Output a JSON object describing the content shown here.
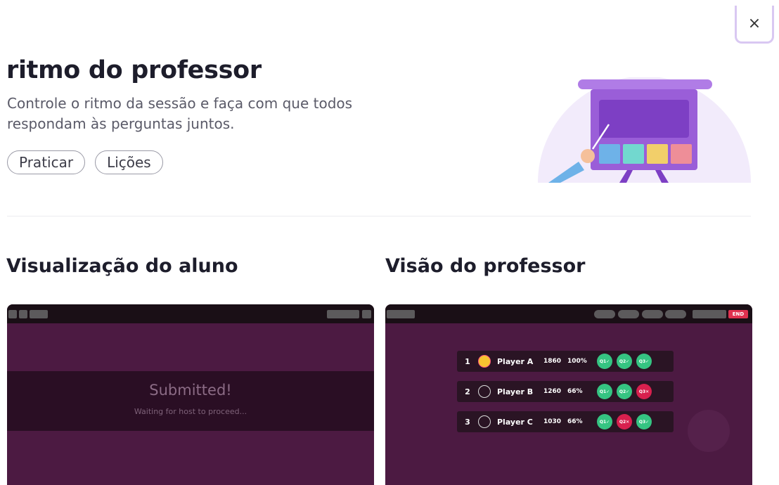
{
  "modal": {
    "close_label": "×"
  },
  "header": {
    "title": "ritmo do professor",
    "subtitle": "Controle o ritmo da sessão e faça com que todos respondam às perguntas juntos.",
    "tags": [
      "Praticar",
      "Lições"
    ]
  },
  "student_view": {
    "title": "Visualização do aluno",
    "status": "Submitted!",
    "message": "Waiting for host to proceed..."
  },
  "teacher_view": {
    "title": "Visão do professor",
    "end_label": "END",
    "players": [
      {
        "rank": "1",
        "name": "Player A",
        "score": "1860",
        "pct": "100%",
        "questions": [
          {
            "label": "Q1✓",
            "ok": true
          },
          {
            "label": "Q2✓",
            "ok": true
          },
          {
            "label": "Q3✓",
            "ok": true
          }
        ]
      },
      {
        "rank": "2",
        "name": "Player B",
        "score": "1260",
        "pct": "66%",
        "questions": [
          {
            "label": "Q1✓",
            "ok": true
          },
          {
            "label": "Q2✓",
            "ok": true
          },
          {
            "label": "Q3✕",
            "ok": false
          }
        ]
      },
      {
        "rank": "3",
        "name": "Player C",
        "score": "1030",
        "pct": "66%",
        "questions": [
          {
            "label": "Q1✓",
            "ok": true
          },
          {
            "label": "Q2✕",
            "ok": false
          },
          {
            "label": "Q3✓",
            "ok": true
          }
        ]
      }
    ]
  },
  "colors": {
    "accent": "#9b5fd8",
    "correct": "#35c482",
    "incorrect": "#d8204e",
    "panel_bg": "#4c1a42"
  },
  "icons": {
    "close": "close-icon",
    "illustration": "teacher-presentation-board-illustration"
  }
}
